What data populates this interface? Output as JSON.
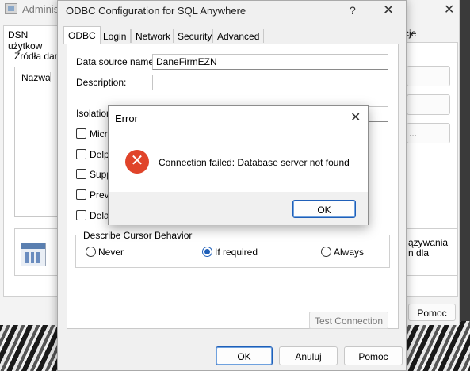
{
  "back_window": {
    "title": "Administ",
    "close_glyph": "✕",
    "tab_user_dsn": "DSN użytkow",
    "tab_right_fragment": "cje",
    "sources_label": "Źródła dany",
    "list_header_name": "Nazwa",
    "list_header_second": "I",
    "btn_configure_fragment": "...",
    "info_text_line1": "ązywania",
    "info_text_line2": "n dla",
    "pomoc_label": "Pomoc"
  },
  "dialog": {
    "title": "ODBC Configuration for SQL Anywhere",
    "help_glyph": "?",
    "close_glyph": "✕",
    "tabs": [
      {
        "label": "ODBC",
        "active": true
      },
      {
        "label": "Login",
        "active": false
      },
      {
        "label": "Network",
        "active": false
      },
      {
        "label": "Security",
        "active": false
      },
      {
        "label": "Advanced",
        "active": false
      }
    ],
    "fields": {
      "data_source_name_label": "Data source name:",
      "data_source_name_value": "DaneFirmEZN",
      "description_label": "Description:",
      "description_value": "",
      "isolation_label": "Isolation"
    },
    "checkboxes": [
      {
        "label": "Micro",
        "checked": false
      },
      {
        "label": "Delph",
        "checked": false
      },
      {
        "label": "Suppr",
        "checked": false
      },
      {
        "label": "Preve",
        "checked": false
      },
      {
        "label": "Delay",
        "checked": false
      }
    ],
    "cursor_group": {
      "title": "Describe Cursor Behavior",
      "options": [
        {
          "label": "Never",
          "selected": false
        },
        {
          "label": "If required",
          "selected": true
        },
        {
          "label": "Always",
          "selected": false
        }
      ]
    },
    "test_connection_label": "Test Connection",
    "ok_label": "OK",
    "cancel_label": "Anuluj",
    "help_label": "Pomoc"
  },
  "error_dialog": {
    "title": "Error",
    "close_glyph": "✕",
    "icon": "error-x-icon",
    "icon_glyph": "✕",
    "message": "Connection failed: Database server not found",
    "ok_label": "OK",
    "icon_color": "#e0442a"
  }
}
